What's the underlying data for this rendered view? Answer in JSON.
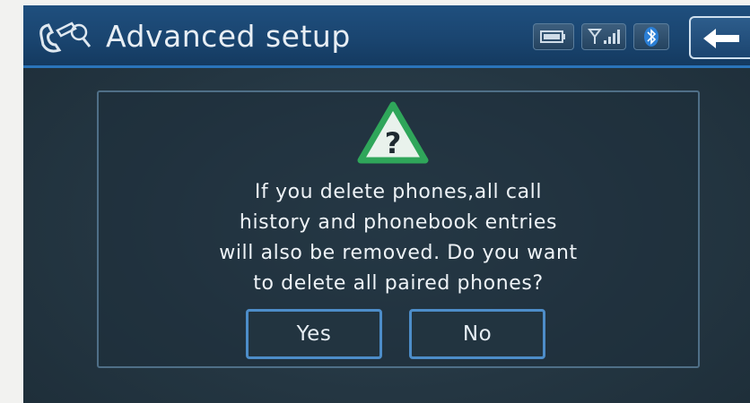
{
  "header": {
    "title": "Advanced setup",
    "icon": "phone-settings-icon",
    "status_icons": [
      "battery-icon",
      "signal-strength-icon",
      "bluetooth-icon"
    ],
    "back_icon": "back-arrow-icon"
  },
  "dialog": {
    "icon": "warning-question-icon",
    "message_lines": [
      "If you delete phones,all call",
      "history and phonebook entries",
      "will also be removed. Do you want",
      "to delete all paired phones?"
    ],
    "yes_label": "Yes",
    "no_label": "No"
  },
  "colors": {
    "header_bg": "#1a4570",
    "header_accent": "#2a74ba",
    "screen_bg": "#243642",
    "button_border": "#4d8dc9",
    "warning_green": "#2fa65a"
  }
}
